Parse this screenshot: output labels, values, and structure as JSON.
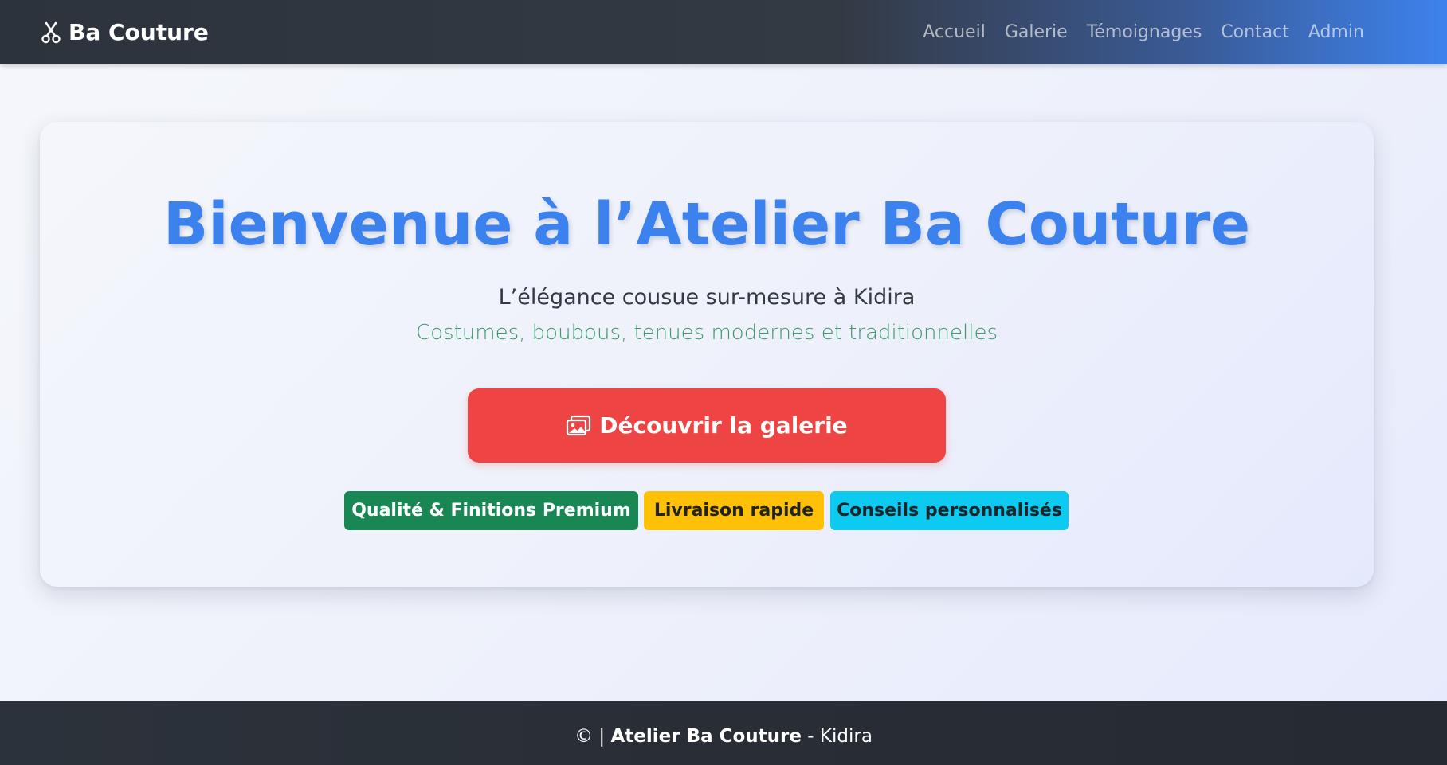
{
  "colors": {
    "accent": "#3c82ee",
    "cta": "#ef4444",
    "tagline": "#3a9a6b",
    "badge_success": "#198754",
    "badge_warning": "#ffc107",
    "badge_info": "#0dcaf0"
  },
  "navbar": {
    "brand_icon": "scissors-icon",
    "brand": "Ba Couture",
    "links": [
      "Accueil",
      "Galerie",
      "Témoignages",
      "Contact",
      "Admin"
    ]
  },
  "hero": {
    "title": "Bienvenue à l’Atelier Ba Couture",
    "subtitle": "L’élégance cousue sur-mesure à Kidira",
    "tagline": "Costumes, boubous, tenues modernes et traditionnelles",
    "cta_icon": "images-icon",
    "cta_label": "Découvrir la galerie",
    "badges": [
      "Qualité & Finitions Premium",
      "Livraison rapide",
      "Conseils personnalisés"
    ]
  },
  "footer": {
    "copyright": "© |",
    "name": "Atelier Ba Couture",
    "location": "- Kidira"
  }
}
